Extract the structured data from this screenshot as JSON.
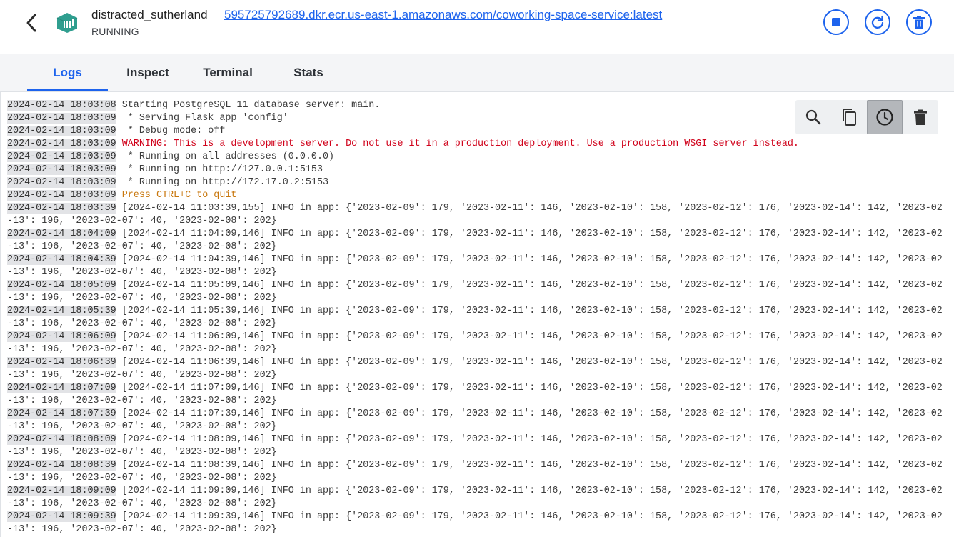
{
  "header": {
    "container_name": "distracted_sutherland",
    "image_link": "595725792689.dkr.ecr.us-east-1.amazonaws.com/coworking-space-service:latest",
    "status": "RUNNING",
    "accent_color": "#1d63ed",
    "icon_color": "#2f9e8f",
    "actions": [
      "stop-icon",
      "restart-icon",
      "delete-icon"
    ]
  },
  "tabs": [
    {
      "label": "Logs",
      "active": true
    },
    {
      "label": "Inspect",
      "active": false
    },
    {
      "label": "Terminal",
      "active": false
    },
    {
      "label": "Stats",
      "active": false
    }
  ],
  "log_toolbar": {
    "tools": [
      "search-icon",
      "copy-icon",
      "timestamps-icon",
      "clear-icon"
    ],
    "active_tool": "timestamps-icon"
  },
  "logs": [
    {
      "ts": "2024-02-14 18:03:08",
      "msg": "Starting PostgreSQL 11 database server: main.",
      "kind": "normal"
    },
    {
      "ts": "2024-02-14 18:03:09",
      "msg": " * Serving Flask app 'config'",
      "kind": "normal"
    },
    {
      "ts": "2024-02-14 18:03:09",
      "msg": " * Debug mode: off",
      "kind": "normal"
    },
    {
      "ts": "2024-02-14 18:03:09",
      "msg": "WARNING: This is a development server. Do not use it in a production deployment. Use a production WSGI server instead.",
      "kind": "warn"
    },
    {
      "ts": "2024-02-14 18:03:09",
      "msg": " * Running on all addresses (0.0.0.0)",
      "kind": "normal"
    },
    {
      "ts": "2024-02-14 18:03:09",
      "msg": " * Running on http://127.0.0.1:5153",
      "kind": "normal"
    },
    {
      "ts": "2024-02-14 18:03:09",
      "msg": " * Running on http://172.17.0.2:5153",
      "kind": "normal"
    },
    {
      "ts": "2024-02-14 18:03:09",
      "msg": "Press CTRL+C to quit",
      "kind": "quit"
    },
    {
      "ts": "2024-02-14 18:03:39",
      "msg": "[2024-02-14 11:03:39,155] INFO in app: {'2023-02-09': 179, '2023-02-11': 146, '2023-02-10': 158, '2023-02-12': 176, '2023-02-14': 142, '2023-02-13': 196, '2023-02-07': 40, '2023-02-08': 202}",
      "kind": "normal"
    },
    {
      "ts": "2024-02-14 18:04:09",
      "msg": "[2024-02-14 11:04:09,146] INFO in app: {'2023-02-09': 179, '2023-02-11': 146, '2023-02-10': 158, '2023-02-12': 176, '2023-02-14': 142, '2023-02-13': 196, '2023-02-07': 40, '2023-02-08': 202}",
      "kind": "normal"
    },
    {
      "ts": "2024-02-14 18:04:39",
      "msg": "[2024-02-14 11:04:39,146] INFO in app: {'2023-02-09': 179, '2023-02-11': 146, '2023-02-10': 158, '2023-02-12': 176, '2023-02-14': 142, '2023-02-13': 196, '2023-02-07': 40, '2023-02-08': 202}",
      "kind": "normal"
    },
    {
      "ts": "2024-02-14 18:05:09",
      "msg": "[2024-02-14 11:05:09,146] INFO in app: {'2023-02-09': 179, '2023-02-11': 146, '2023-02-10': 158, '2023-02-12': 176, '2023-02-14': 142, '2023-02-13': 196, '2023-02-07': 40, '2023-02-08': 202}",
      "kind": "normal"
    },
    {
      "ts": "2024-02-14 18:05:39",
      "msg": "[2024-02-14 11:05:39,146] INFO in app: {'2023-02-09': 179, '2023-02-11': 146, '2023-02-10': 158, '2023-02-12': 176, '2023-02-14': 142, '2023-02-13': 196, '2023-02-07': 40, '2023-02-08': 202}",
      "kind": "normal"
    },
    {
      "ts": "2024-02-14 18:06:09",
      "msg": "[2024-02-14 11:06:09,146] INFO in app: {'2023-02-09': 179, '2023-02-11': 146, '2023-02-10': 158, '2023-02-12': 176, '2023-02-14': 142, '2023-02-13': 196, '2023-02-07': 40, '2023-02-08': 202}",
      "kind": "normal"
    },
    {
      "ts": "2024-02-14 18:06:39",
      "msg": "[2024-02-14 11:06:39,146] INFO in app: {'2023-02-09': 179, '2023-02-11': 146, '2023-02-10': 158, '2023-02-12': 176, '2023-02-14': 142, '2023-02-13': 196, '2023-02-07': 40, '2023-02-08': 202}",
      "kind": "normal"
    },
    {
      "ts": "2024-02-14 18:07:09",
      "msg": "[2024-02-14 11:07:09,146] INFO in app: {'2023-02-09': 179, '2023-02-11': 146, '2023-02-10': 158, '2023-02-12': 176, '2023-02-14': 142, '2023-02-13': 196, '2023-02-07': 40, '2023-02-08': 202}",
      "kind": "normal"
    },
    {
      "ts": "2024-02-14 18:07:39",
      "msg": "[2024-02-14 11:07:39,146] INFO in app: {'2023-02-09': 179, '2023-02-11': 146, '2023-02-10': 158, '2023-02-12': 176, '2023-02-14': 142, '2023-02-13': 196, '2023-02-07': 40, '2023-02-08': 202}",
      "kind": "normal"
    },
    {
      "ts": "2024-02-14 18:08:09",
      "msg": "[2024-02-14 11:08:09,146] INFO in app: {'2023-02-09': 179, '2023-02-11': 146, '2023-02-10': 158, '2023-02-12': 176, '2023-02-14': 142, '2023-02-13': 196, '2023-02-07': 40, '2023-02-08': 202}",
      "kind": "normal"
    },
    {
      "ts": "2024-02-14 18:08:39",
      "msg": "[2024-02-14 11:08:39,146] INFO in app: {'2023-02-09': 179, '2023-02-11': 146, '2023-02-10': 158, '2023-02-12': 176, '2023-02-14': 142, '2023-02-13': 196, '2023-02-07': 40, '2023-02-08': 202}",
      "kind": "normal"
    },
    {
      "ts": "2024-02-14 18:09:09",
      "msg": "[2024-02-14 11:09:09,146] INFO in app: {'2023-02-09': 179, '2023-02-11': 146, '2023-02-10': 158, '2023-02-12': 176, '2023-02-14': 142, '2023-02-13': 196, '2023-02-07': 40, '2023-02-08': 202}",
      "kind": "normal"
    },
    {
      "ts": "2024-02-14 18:09:39",
      "msg": "[2024-02-14 11:09:39,146] INFO in app: {'2023-02-09': 179, '2023-02-11': 146, '2023-02-10': 158, '2023-02-12': 176, '2023-02-14': 142, '2023-02-13': 196, '2023-02-07': 40, '2023-02-08': 202}",
      "kind": "normal"
    }
  ]
}
